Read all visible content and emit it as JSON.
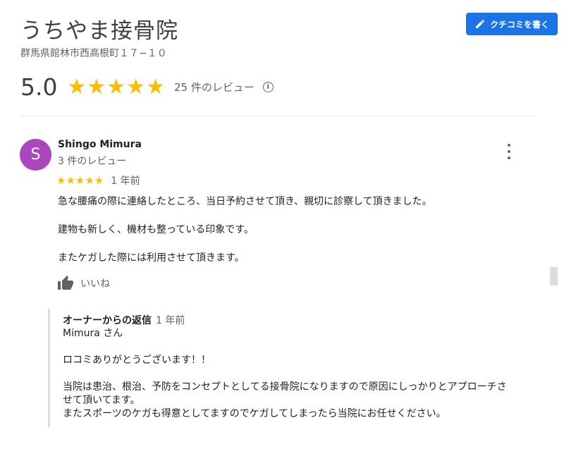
{
  "place": {
    "name": "うちやま接骨院",
    "address": "群馬県館林市西高根町１７−１０"
  },
  "write_review_button": {
    "label": "クチコミを書く",
    "icon": "pencil-icon",
    "color": "#1a73e8"
  },
  "rating": {
    "value": "5.0",
    "stars": "★★★★★",
    "count_text": "25 件のレビュー",
    "star_color": "#fbbc04"
  },
  "review": {
    "avatar_letter": "S",
    "avatar_color": "#ab47bc",
    "reviewer_name": "Shingo Mimura",
    "reviewer_sub": "3 件のレビュー",
    "stars": "★★★★★",
    "time": "1 年前",
    "paragraphs": [
      "急な腰痛の際に連絡したところ、当日予約させて頂き、親切に診察して頂きました。",
      "建物も新しく、機材も整っている印象です。",
      "またケガした際には利用させて頂きます。"
    ],
    "like_label": "いいね"
  },
  "owner_reply": {
    "title": "オーナーからの返信",
    "time": "1 年前",
    "lines": {
      "greeting": "Mimura さん",
      "thanks": "ロコミありがとうございます！！",
      "body1": "当院は患治、根治、予防をコンセプトとしてる接骨院になりますので原因にしっかりとアプローチさ",
      "body2": "せて頂いてます。",
      "body3": "またスポーツのケガも得意としてますのでケガしてしまったら当院にお任せください。"
    }
  }
}
